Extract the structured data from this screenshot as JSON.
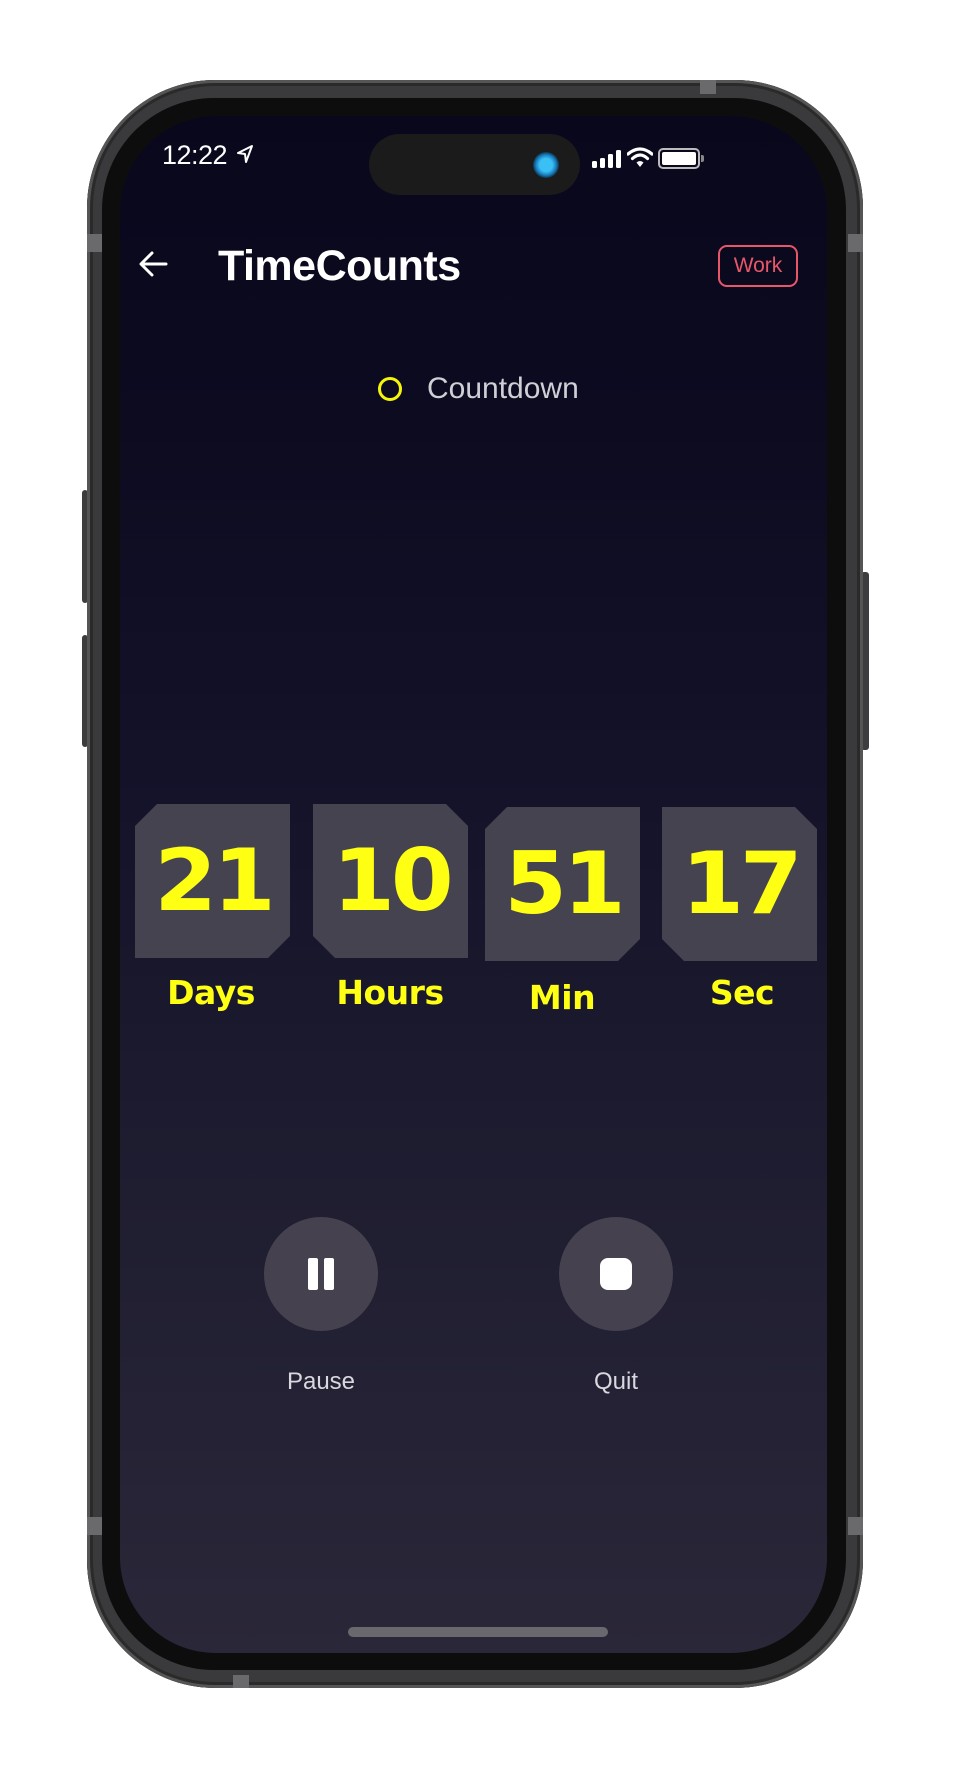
{
  "status_bar": {
    "time": "12:22",
    "icons": [
      "location-arrow-icon",
      "cellular-signal-icon",
      "wifi-icon",
      "battery-icon"
    ]
  },
  "header": {
    "back_icon": "arrow-left-icon",
    "title": "TimeCounts",
    "tag_label": "Work",
    "tag_color": "#e8566a"
  },
  "mode": {
    "icon": "ring-icon",
    "label": "Countdown",
    "accent": "#f5f50a"
  },
  "countdown": {
    "units": [
      {
        "value": "21",
        "label": "Days"
      },
      {
        "value": "10",
        "label": "Hours"
      },
      {
        "value": "51",
        "label": "Min"
      },
      {
        "value": "17",
        "label": "Sec"
      }
    ],
    "digit_color": "#ffff14",
    "tile_color": "#45434f"
  },
  "controls": {
    "pause": {
      "icon": "pause-icon",
      "label": "Pause"
    },
    "quit": {
      "icon": "stop-icon",
      "label": "Quit"
    }
  }
}
